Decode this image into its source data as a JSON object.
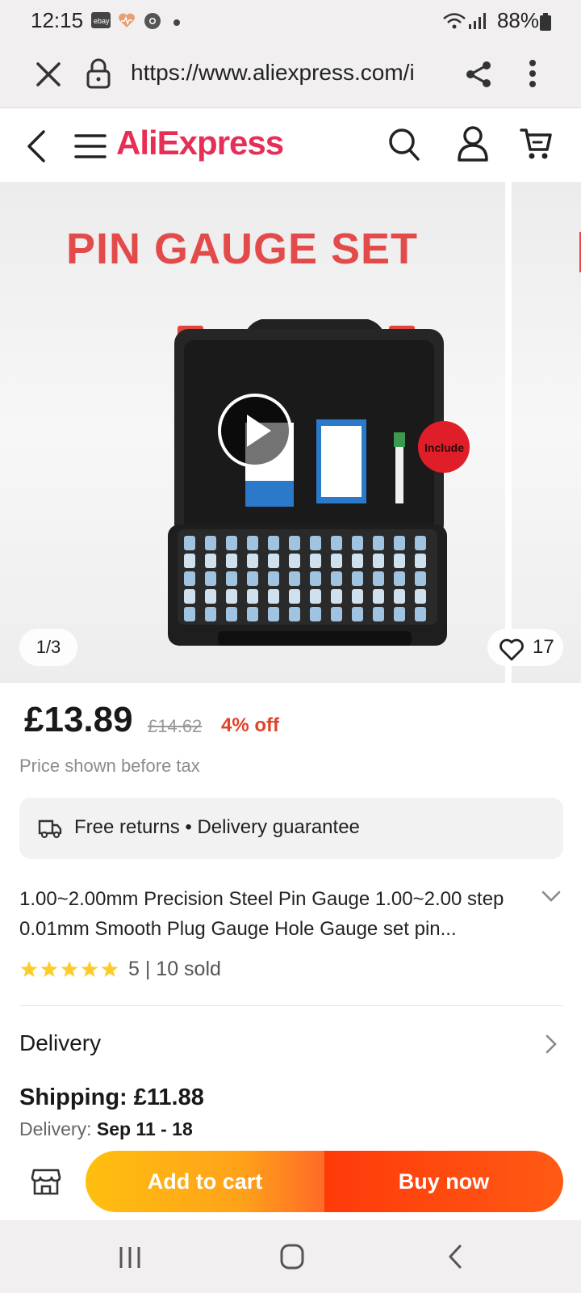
{
  "status_bar": {
    "time": "12:15",
    "notification_icons": [
      "ebay-icon",
      "heart-health-icon",
      "chrome-icon",
      "dot-icon"
    ],
    "battery": "88%"
  },
  "browser": {
    "url": "https://www.aliexpress.com/i"
  },
  "header": {
    "logo": "AliExpress"
  },
  "gallery": {
    "image_text": "PIN GAUGE SET",
    "badge_text": "Include",
    "counter": "1/3",
    "likes": "17"
  },
  "product": {
    "price": "£13.89",
    "old_price": "£14.62",
    "discount": "4% off",
    "tax_note": "Price shown before tax",
    "returns": "Free returns • Delivery guarantee",
    "title": "1.00~2.00mm Precision Steel Pin Gauge 1.00~2.00 step 0.01mm Smooth Plug Gauge Hole Gauge set pin...",
    "rating_value": 5,
    "rating_text": "5 | 10 sold"
  },
  "delivery": {
    "label": "Delivery",
    "shipping": "Shipping:  £11.88",
    "date_label": "Delivery: ",
    "date_value": "Sep 11 - 18"
  },
  "actions": {
    "add_to_cart": "Add to cart",
    "buy_now": "Buy now"
  },
  "colors": {
    "brand": "#e62e56",
    "discount": "#e0432b",
    "cart_button": "#ffa21a",
    "buy_button": "#ff3a0a"
  }
}
